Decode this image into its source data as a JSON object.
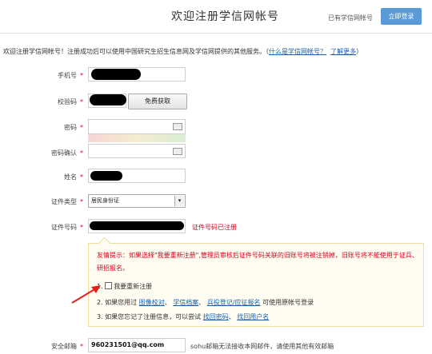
{
  "header": {
    "title": "欢迎注册学信网帐号",
    "have_account": "已有学信网帐号",
    "login_button": "立即登录"
  },
  "intro": {
    "text": "欢迎注册学信网帐号！注册成功后可以使用中国研究生招生信息网及学信网提供的其他服务。（",
    "link1": "什么是学信网帐号？",
    "link2": "了解更多",
    "close": "）"
  },
  "form": {
    "phone_label": "手机号",
    "code_label": "校验码",
    "get_code_button": "免费获取",
    "password_label": "密码",
    "confirm_label": "密码确认",
    "name_label": "姓名",
    "idtype_label": "证件类型",
    "idtype_value": "居民身份证",
    "idnum_label": "证件号码",
    "idnum_error": "证件号码已注册",
    "required_mark": "*",
    "email_label": "安全邮箱",
    "email_value": "960231501@qq.com",
    "email_hint": "sohu邮箱无法接收本网邮件，请使用其他有效邮箱"
  },
  "notice": {
    "tip": "友情提示：如果选择\"我要重新注册\",管理员审核后证件号码关联的旧账号将被注销掉，旧账号将不能使用于证兵、研招报名。",
    "opt1": "1.",
    "opt1_label": "我要重新注册",
    "opt2_prefix": "2. 如果您用过",
    "opt2_link1": "图像校对",
    "opt2_sep": "、",
    "opt2_link2": "学信档案",
    "opt2_link3": "兵役登记/应征报名",
    "opt2_suffix": "可使用原帐号登录",
    "opt3_prefix": "3. 如果您忘记了注册信息，可以尝试",
    "opt3_link1": "找回密码",
    "opt3_link2": "找回用户名"
  },
  "colors": {
    "accent": "#5a9ad6",
    "error": "#d9001b",
    "link": "#1a5fa8"
  }
}
